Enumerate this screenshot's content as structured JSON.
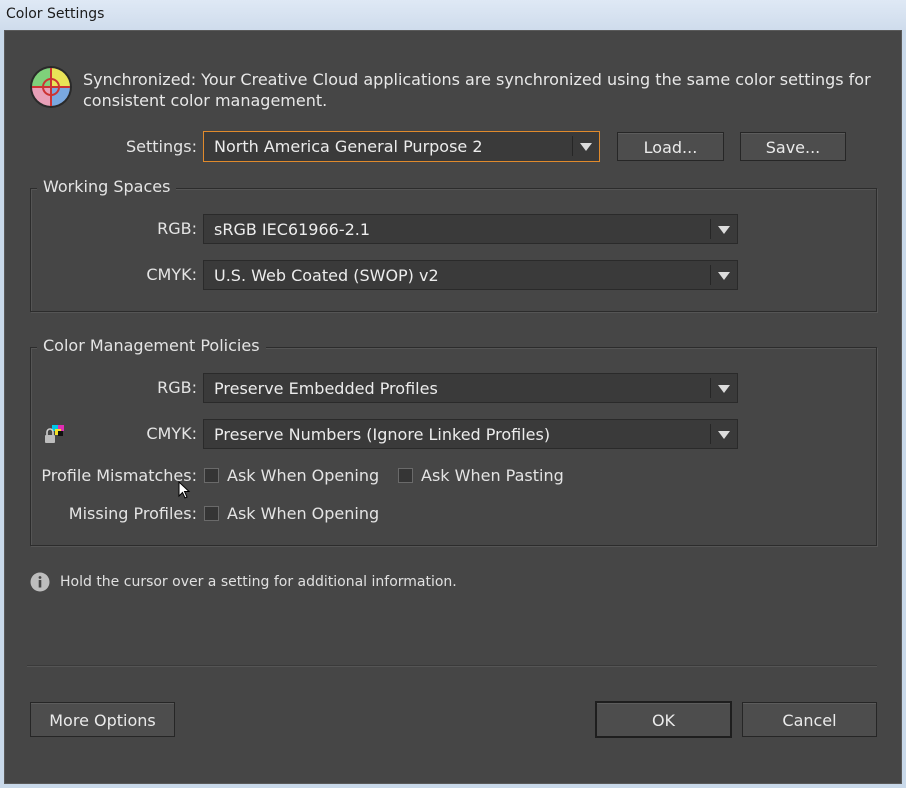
{
  "window": {
    "title": "Color Settings"
  },
  "sync": {
    "message": "Synchronized: Your Creative Cloud applications are synchronized using the same color settings for consistent color management."
  },
  "settings": {
    "label": "Settings:",
    "value": "North America General Purpose 2",
    "load_label": "Load...",
    "save_label": "Save..."
  },
  "working_spaces": {
    "legend": "Working Spaces",
    "rgb_label": "RGB:",
    "rgb_value": "sRGB IEC61966-2.1",
    "cmyk_label": "CMYK:",
    "cmyk_value": "U.S. Web Coated (SWOP) v2"
  },
  "policies": {
    "legend": "Color Management Policies",
    "rgb_label": "RGB:",
    "rgb_value": "Preserve Embedded Profiles",
    "cmyk_label": "CMYK:",
    "cmyk_value": "Preserve Numbers (Ignore Linked Profiles)",
    "mismatch_label": "Profile Mismatches:",
    "mismatch_open_label": "Ask When Opening",
    "mismatch_paste_label": "Ask When Pasting",
    "missing_label": "Missing Profiles:",
    "missing_open_label": "Ask When Opening"
  },
  "info": {
    "text": "Hold the cursor over a setting for additional information."
  },
  "buttons": {
    "more_options": "More Options",
    "ok": "OK",
    "cancel": "Cancel"
  },
  "colors": {
    "background": "#464646",
    "focus_border": "#e08a2c"
  }
}
